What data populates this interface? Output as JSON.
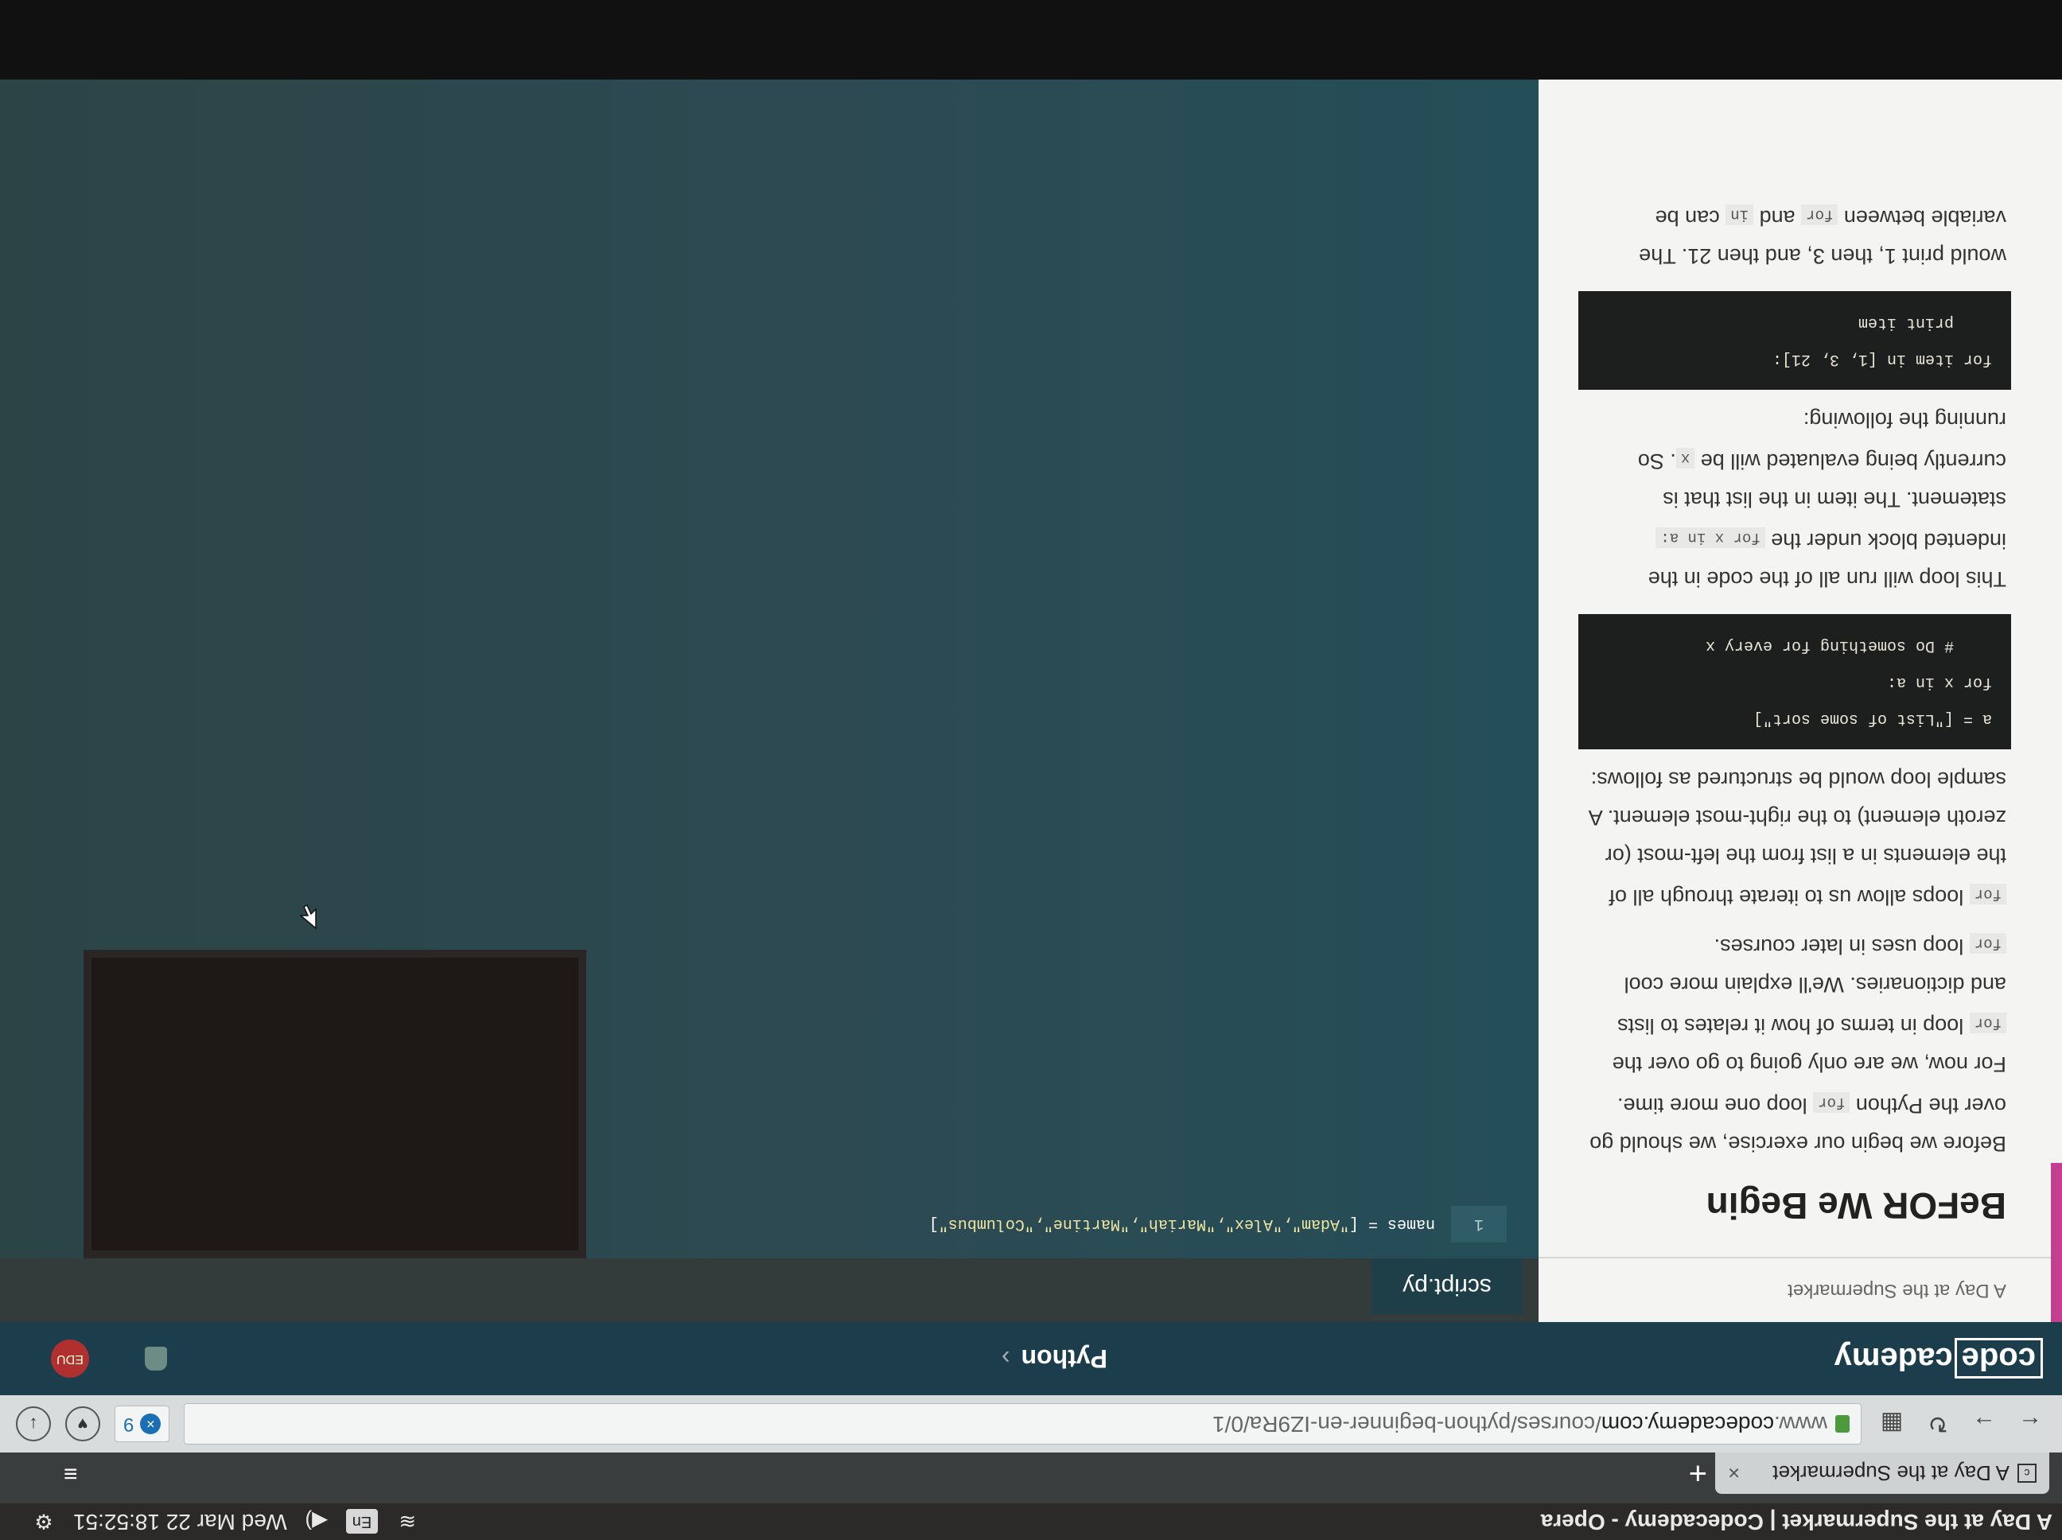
{
  "os": {
    "window_title": "A Day at the Supermarket | Codecademy - Opera",
    "lang": "En",
    "datetime": "Wed Mar 22 18:52:51"
  },
  "browser": {
    "tab_title": "A Day at the Supermarket",
    "url_prefix": "www.",
    "url_domain": "codecademy.com",
    "url_path": "/courses/python-beginner-en-IZ9Ra/0/1",
    "ext_count": "9"
  },
  "codecademy": {
    "logo_boxed": "code",
    "logo_rest": "cademy",
    "course": "Python",
    "avatar_text": "EDU"
  },
  "lesson": {
    "breadcrumb": "A Day at the Supermarket",
    "title": "BeFOR We Begin",
    "p1_a": "Before we begin our exercise, we should go over the Python",
    "p1_code": "for",
    "p1_b": "loop one more time. For now, we are only going to go over the",
    "p1_code2": "for",
    "p1_c": "loop in terms of how it relates to lists and dictionaries. We'll explain more cool",
    "p1_code3": "for",
    "p1_d": "loop uses in later courses.",
    "p2_code": "for",
    "p2_a": "loops allow us to iterate through all of the elements in a list from the left-most (or zeroth element) to the right-most element. A sample loop would be structured as follows:",
    "code1": "a = [\"List of some sort\"]\nfor x in a:\n    # Do something for every x",
    "p3_a": "This loop will run all of the code in the indented block under the",
    "p3_code": "for x in a:",
    "p3_b": "statement. The item in the list that is currently being evaluated will be",
    "p3_code2": "x",
    "p3_c": ". So running the following:",
    "code2": "for item in [1, 3, 21]:\n    print item",
    "p4_a": "would print 1, then 3, and then 21. The variable between",
    "p4_code": "for",
    "p4_b": "and",
    "p4_code2": "in",
    "p4_c": "can be"
  },
  "editor": {
    "filename": "script.py",
    "line_number": "1",
    "code_prefix": "names = [",
    "code_strings": "\"Adam\",\"Alex\",\"Mariah\",\"Martine\",\"Columbus\"",
    "code_suffix": "]"
  }
}
